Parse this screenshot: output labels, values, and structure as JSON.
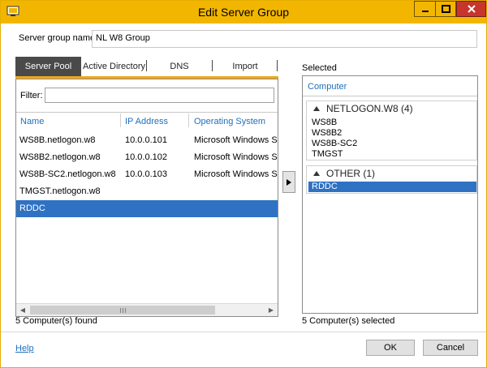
{
  "window": {
    "title": "Edit Server Group",
    "accent_color": "#f3b600",
    "close_color": "#c7352c"
  },
  "form": {
    "group_label": "Server group name",
    "group_value": "NL W8 Group"
  },
  "tabs": [
    {
      "label": "Server Pool",
      "active": true
    },
    {
      "label": "Active Directory",
      "active": false
    },
    {
      "label": "DNS",
      "active": false
    },
    {
      "label": "Import",
      "active": false
    }
  ],
  "server_pool": {
    "filter_label": "Filter:",
    "filter_value": "",
    "columns": [
      "Name",
      "IP Address",
      "Operating System"
    ],
    "rows": [
      {
        "name": "WS8B.netlogon.w8",
        "ip": "10.0.0.101",
        "os": "Microsoft Windows Ser",
        "selected": false
      },
      {
        "name": "WS8B2.netlogon.w8",
        "ip": "10.0.0.102",
        "os": "Microsoft Windows Ser",
        "selected": false
      },
      {
        "name": "WS8B-SC2.netlogon.w8",
        "ip": "10.0.0.103",
        "os": "Microsoft Windows Ser",
        "selected": false
      },
      {
        "name": "TMGST.netlogon.w8",
        "ip": "",
        "os": "",
        "selected": false
      },
      {
        "name": "RDDC",
        "ip": "",
        "os": "",
        "selected": true
      }
    ],
    "status": "5 Computer(s) found"
  },
  "selected": {
    "label": "Selected",
    "column": "Computer",
    "groups": [
      {
        "title": "NETLOGON.W8 (4)",
        "items": [
          "WS8B",
          "WS8B2",
          "WS8B-SC2",
          "TMGST"
        ]
      },
      {
        "title": "OTHER (1)",
        "items": [
          "RDDC"
        ]
      }
    ],
    "status": "5 Computer(s) selected"
  },
  "footer": {
    "help": "Help",
    "ok": "OK",
    "cancel": "Cancel"
  }
}
